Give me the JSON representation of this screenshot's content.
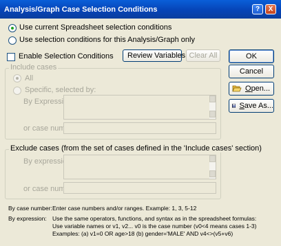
{
  "window": {
    "title": "Analysis/Graph Case Selection Conditions",
    "help_glyph": "?",
    "close_glyph": "X"
  },
  "source": {
    "option_spreadsheet": "Use current Spreadsheet selection conditions",
    "option_this": "Use selection conditions for this Analysis/Graph only",
    "selected": "option_spreadsheet"
  },
  "enable": {
    "label": "Enable Selection Conditions",
    "checked": false
  },
  "toolbar": {
    "review_variables": "Review Variables:",
    "clear_all": "Clear All"
  },
  "include": {
    "title": "Include cases",
    "all": "All",
    "specific": "Specific, selected by:",
    "by_expression": "By Expression:",
    "or_case_number": "or case number:"
  },
  "exclude": {
    "title": "Exclude cases (from the set of cases defined in the 'Include cases' section)",
    "by_expression": "By expression:",
    "or_case_number": "or case number:"
  },
  "buttons": {
    "ok": "OK",
    "cancel": "Cancel",
    "open": "Open...",
    "save_as": "Save As..."
  },
  "help_notes": {
    "by_case_number_label": "By case number:",
    "by_case_number_text": "Enter case numbers and/or ranges.  Example:  1, 3, 5-12",
    "by_expression_label": "By expression:",
    "line1": "Use the same operators, functions, and syntax as in the spreadsheet formulas:",
    "line2": "Use variable names or v1, v2...   v0 is the case number  (v0<4 means cases 1-3)",
    "line3": "Examples:  (a) v1=0 OR age>18   (b) gender='MALE' AND v4<>(v5+v6)"
  },
  "colors": {
    "titlebar": "#0a5fd8",
    "dialog_bg": "#ece9d8",
    "radio_dot": "#21a121",
    "button_border": "#003c74"
  }
}
